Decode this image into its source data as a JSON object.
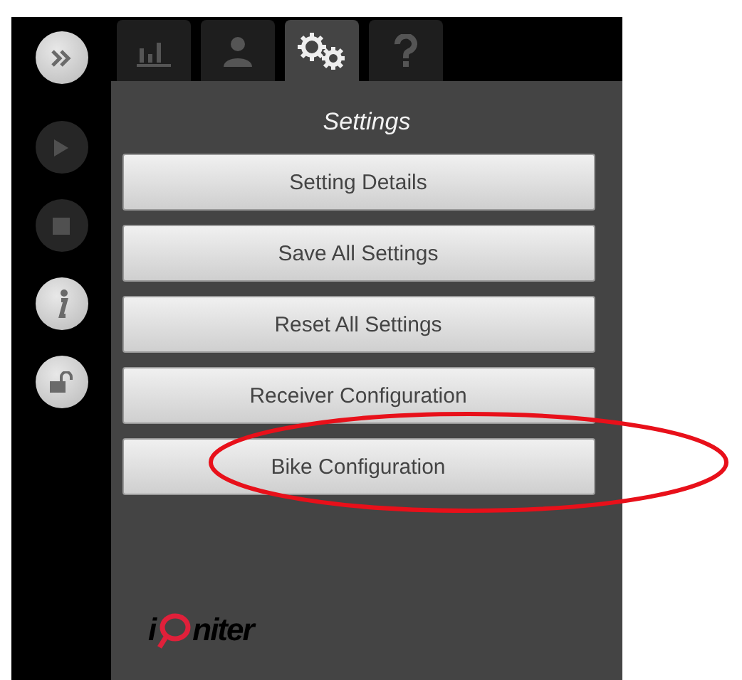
{
  "sidebar": {
    "buttons": [
      {
        "kind": "expand",
        "disabled": false
      },
      {
        "kind": "play",
        "disabled": true
      },
      {
        "kind": "stop",
        "disabled": true
      },
      {
        "kind": "info",
        "disabled": false
      },
      {
        "kind": "lock",
        "disabled": false
      }
    ]
  },
  "tabs": [
    {
      "kind": "chart",
      "selected": false
    },
    {
      "kind": "person",
      "selected": false
    },
    {
      "kind": "settings",
      "selected": true
    },
    {
      "kind": "help",
      "selected": false
    }
  ],
  "panel": {
    "title": "Settings",
    "buttons": [
      {
        "label": "Setting Details",
        "highlighted": false
      },
      {
        "label": "Save All Settings",
        "highlighted": false
      },
      {
        "label": "Reset All Settings",
        "highlighted": false
      },
      {
        "label": "Receiver Configuration",
        "highlighted": false
      },
      {
        "label": "Bike Configuration",
        "highlighted": true
      }
    ]
  },
  "logo": {
    "lead": "i",
    "tail": "niter"
  }
}
